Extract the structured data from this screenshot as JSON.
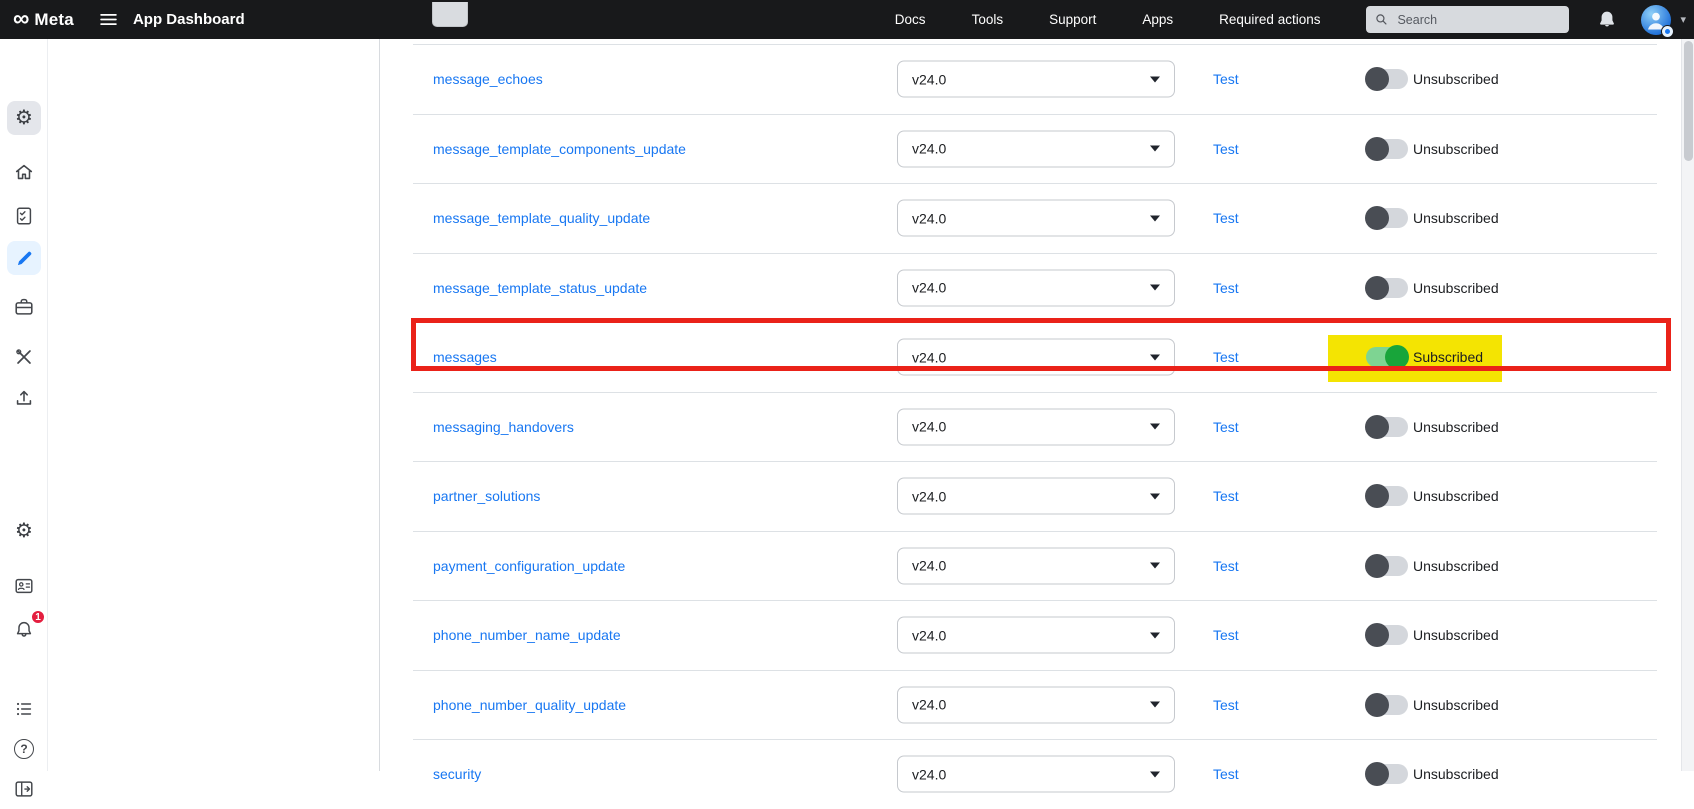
{
  "icons": {
    "infinity_glyph": "∞",
    "gear_glyph": "⚙",
    "question_glyph": "?",
    "caret_glyph": "▾"
  },
  "header": {
    "brand": "Meta",
    "title": "App Dashboard",
    "nav": [
      {
        "label": "Docs"
      },
      {
        "label": "Tools"
      },
      {
        "label": "Support"
      },
      {
        "label": "Apps"
      },
      {
        "label": "Required actions"
      }
    ],
    "search": {
      "placeholder": "Search"
    }
  },
  "sidebar": {
    "alerts_badge": "1",
    "items": [
      {
        "name": "app-icon",
        "icon": "gear"
      },
      {
        "name": "home",
        "icon": "home"
      },
      {
        "name": "requirements",
        "icon": "checklist-document"
      },
      {
        "name": "edit-app",
        "icon": "pencil",
        "active": true
      },
      {
        "name": "app-roles",
        "icon": "briefcase"
      },
      {
        "name": "tools",
        "icon": "crossed-tools"
      },
      {
        "name": "go-live",
        "icon": "arrow-up-tray"
      },
      {
        "name": "app-settings",
        "icon": "gear"
      },
      {
        "name": "contact-card",
        "icon": "id-card"
      },
      {
        "name": "notifications",
        "icon": "bell",
        "badge": "1"
      },
      {
        "name": "activity-log",
        "icon": "bulleted-list"
      },
      {
        "name": "help",
        "icon": "question-mark"
      },
      {
        "name": "collapse-sidebar",
        "icon": "collapse-panel"
      }
    ]
  },
  "table": {
    "rows": [
      {
        "field": "message_echoes",
        "version": "v24.0",
        "test": "Test",
        "status": "Unsubscribed",
        "subscribed": false
      },
      {
        "field": "message_template_components_update",
        "version": "v24.0",
        "test": "Test",
        "status": "Unsubscribed",
        "subscribed": false
      },
      {
        "field": "message_template_quality_update",
        "version": "v24.0",
        "test": "Test",
        "status": "Unsubscribed",
        "subscribed": false
      },
      {
        "field": "message_template_status_update",
        "version": "v24.0",
        "test": "Test",
        "status": "Unsubscribed",
        "subscribed": false
      },
      {
        "field": "messages",
        "version": "v24.0",
        "test": "Test",
        "status": "Subscribed",
        "subscribed": true
      },
      {
        "field": "messaging_handovers",
        "version": "v24.0",
        "test": "Test",
        "status": "Unsubscribed",
        "subscribed": false
      },
      {
        "field": "partner_solutions",
        "version": "v24.0",
        "test": "Test",
        "status": "Unsubscribed",
        "subscribed": false
      },
      {
        "field": "payment_configuration_update",
        "version": "v24.0",
        "test": "Test",
        "status": "Unsubscribed",
        "subscribed": false
      },
      {
        "field": "phone_number_name_update",
        "version": "v24.0",
        "test": "Test",
        "status": "Unsubscribed",
        "subscribed": false
      },
      {
        "field": "phone_number_quality_update",
        "version": "v24.0",
        "test": "Test",
        "status": "Unsubscribed",
        "subscribed": false
      },
      {
        "field": "security",
        "version": "v24.0",
        "test": "Test",
        "status": "Unsubscribed",
        "subscribed": false
      }
    ]
  },
  "annotations": {
    "red_box_color": "#ea2219",
    "yellow_highlight_color": "#f4e402"
  },
  "colors": {
    "link": "#1877f2",
    "header_bg": "#18191b",
    "toggle_on_knob": "#18a53a"
  }
}
